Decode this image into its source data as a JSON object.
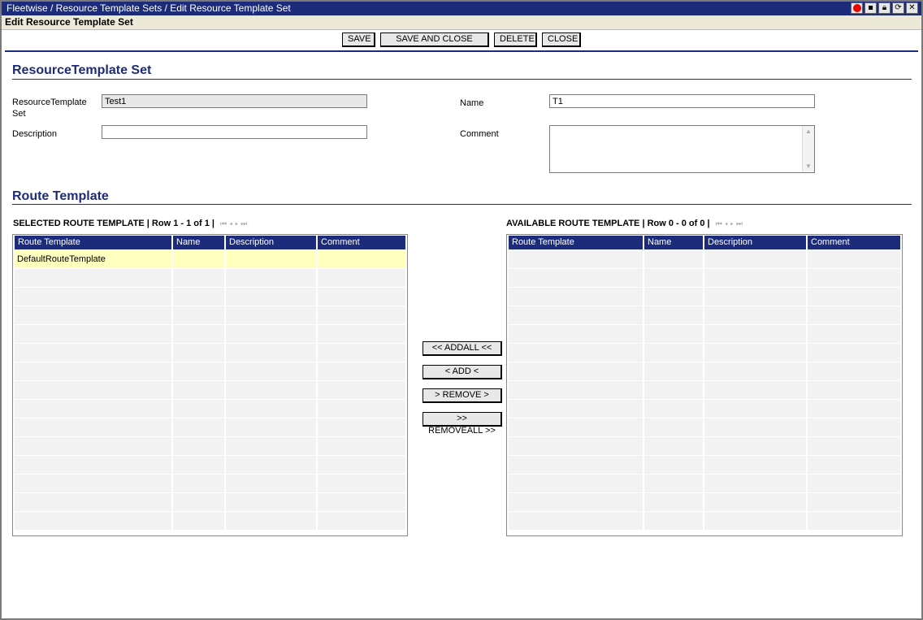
{
  "window": {
    "breadcrumb": "Fleetwise / Resource Template Sets / Edit Resource Template Set",
    "subtitle": "Edit Resource Template Set"
  },
  "title_icons": [
    "record-icon",
    "save-icon",
    "lock-icon",
    "refresh-icon",
    "close-icon"
  ],
  "toolbar": {
    "save": "SAVE",
    "save_close": "SAVE AND CLOSE",
    "delete": "DELETE",
    "close": "CLOSE"
  },
  "set_section": {
    "title": "ResourceTemplate Set",
    "rt_set_label": "ResourceTemplate Set",
    "rt_set_value": "Test1",
    "name_label": "Name",
    "name_value": "T1",
    "description_label": "Description",
    "description_value": "",
    "comment_label": "Comment",
    "comment_value": ""
  },
  "route_section": {
    "title": "Route Template"
  },
  "selected": {
    "heading": "SELECTED ROUTE TEMPLATE | Row 1 - 1 of 1 |",
    "columns": [
      "Route Template",
      "Name",
      "Description",
      "Comment"
    ],
    "rows": [
      [
        "DefaultRouteTemplate",
        "",
        "",
        ""
      ]
    ]
  },
  "available": {
    "heading": "AVAILABLE ROUTE TEMPLATE | Row 0 - 0 of 0 |",
    "columns": [
      "Route Template",
      "Name",
      "Description",
      "Comment"
    ],
    "rows": []
  },
  "transfer": {
    "add_all": "<< ADDALL <<",
    "add": "< ADD <",
    "remove": "> REMOVE >",
    "remove_all": ">> REMOVEALL >>"
  },
  "colors": {
    "accent": "#1c2c7a",
    "selected_row": "#ffffc0"
  }
}
